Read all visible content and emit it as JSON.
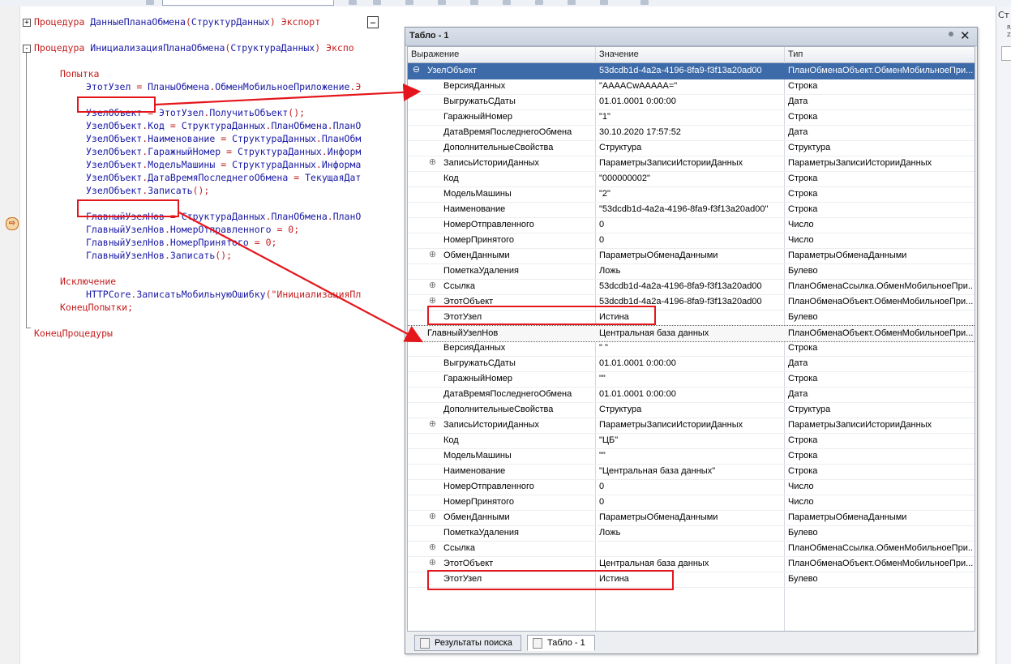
{
  "editor": {
    "lines": [
      {
        "fold": "+",
        "parts": [
          {
            "t": "Процедура ",
            "c": "kw"
          },
          {
            "t": "ДанныеПланаОбмена",
            "c": "id"
          },
          {
            "t": "(",
            "c": "kw"
          },
          {
            "t": "СтруктурДанных",
            "c": "id"
          },
          {
            "t": ") ",
            "c": "kw"
          },
          {
            "t": "Экспорт",
            "c": "kw"
          }
        ]
      },
      {
        "fold": "-",
        "parts": [
          {
            "t": "Процедура ",
            "c": "kw"
          },
          {
            "t": "ИнициализацияПланаОбмена",
            "c": "id"
          },
          {
            "t": "(",
            "c": "kw"
          },
          {
            "t": "СтруктураДанных",
            "c": "id"
          },
          {
            "t": ") ",
            "c": "kw"
          },
          {
            "t": "Экспо",
            "c": "kw"
          }
        ]
      },
      {
        "parts": [
          {
            "t": "Попытка",
            "c": "kw"
          }
        ]
      },
      {
        "parts": [
          {
            "t": "ЭтотУзел ",
            "c": "id"
          },
          {
            "t": "= ",
            "c": "kw"
          },
          {
            "t": "ПланыОбмена",
            "c": "id"
          },
          {
            "t": ".",
            "c": "kw"
          },
          {
            "t": "ОбменМобильноеПриложение",
            "c": "id"
          },
          {
            "t": ".Э",
            "c": "kw"
          }
        ]
      },
      {
        "parts": [
          {
            "t": "УзелОбъект ",
            "c": "id"
          },
          {
            "t": "= ",
            "c": "kw"
          },
          {
            "t": "ЭтотУзел",
            "c": "id"
          },
          {
            "t": ".",
            "c": "kw"
          },
          {
            "t": "ПолучитьОбъект",
            "c": "id"
          },
          {
            "t": "();",
            "c": "kw"
          }
        ]
      },
      {
        "parts": [
          {
            "t": "УзелОбъект",
            "c": "id"
          },
          {
            "t": ".",
            "c": "kw"
          },
          {
            "t": "Код ",
            "c": "id"
          },
          {
            "t": "= ",
            "c": "kw"
          },
          {
            "t": "СтруктураДанных",
            "c": "id"
          },
          {
            "t": ".",
            "c": "kw"
          },
          {
            "t": "ПланОбмена",
            "c": "id"
          },
          {
            "t": ".",
            "c": "kw"
          },
          {
            "t": "ПланО",
            "c": "id"
          }
        ]
      },
      {
        "parts": [
          {
            "t": "УзелОбъект",
            "c": "id"
          },
          {
            "t": ".",
            "c": "kw"
          },
          {
            "t": "Наименование ",
            "c": "id"
          },
          {
            "t": "= ",
            "c": "kw"
          },
          {
            "t": "СтруктураДанных",
            "c": "id"
          },
          {
            "t": ".",
            "c": "kw"
          },
          {
            "t": "ПланОбм",
            "c": "id"
          }
        ]
      },
      {
        "parts": [
          {
            "t": "УзелОбъект",
            "c": "id"
          },
          {
            "t": ".",
            "c": "kw"
          },
          {
            "t": "ГаражныйНомер ",
            "c": "id"
          },
          {
            "t": "= ",
            "c": "kw"
          },
          {
            "t": "СтруктураДанных",
            "c": "id"
          },
          {
            "t": ".",
            "c": "kw"
          },
          {
            "t": "Информ",
            "c": "id"
          }
        ]
      },
      {
        "parts": [
          {
            "t": "УзелОбъект",
            "c": "id"
          },
          {
            "t": ".",
            "c": "kw"
          },
          {
            "t": "МодельМашины ",
            "c": "id"
          },
          {
            "t": "= ",
            "c": "kw"
          },
          {
            "t": "СтруктураДанных",
            "c": "id"
          },
          {
            "t": ".",
            "c": "kw"
          },
          {
            "t": "Информа",
            "c": "id"
          }
        ]
      },
      {
        "parts": [
          {
            "t": "УзелОбъект",
            "c": "id"
          },
          {
            "t": ".",
            "c": "kw"
          },
          {
            "t": "ДатаВремяПоследнегоОбмена ",
            "c": "id"
          },
          {
            "t": "= ",
            "c": "kw"
          },
          {
            "t": "ТекущаяДат",
            "c": "id"
          }
        ]
      },
      {
        "parts": [
          {
            "t": "УзелОбъект",
            "c": "id"
          },
          {
            "t": ".",
            "c": "kw"
          },
          {
            "t": "Записать",
            "c": "id"
          },
          {
            "t": "();",
            "c": "kw"
          }
        ]
      },
      {
        "parts": [
          {
            "t": "ГлавныйУзелНов ",
            "c": "id"
          },
          {
            "t": "= ",
            "c": "kw"
          },
          {
            "t": "СтруктураДанных",
            "c": "id"
          },
          {
            "t": ".",
            "c": "kw"
          },
          {
            "t": "ПланОбмена",
            "c": "id"
          },
          {
            "t": ".",
            "c": "kw"
          },
          {
            "t": "ПланО",
            "c": "id"
          }
        ]
      },
      {
        "parts": [
          {
            "t": "ГлавныйУзелНов",
            "c": "id"
          },
          {
            "t": ".",
            "c": "kw"
          },
          {
            "t": "НомерОтправленного ",
            "c": "id"
          },
          {
            "t": "= 0;",
            "c": "kw"
          }
        ]
      },
      {
        "parts": [
          {
            "t": "ГлавныйУзелНов",
            "c": "id"
          },
          {
            "t": ".",
            "c": "kw"
          },
          {
            "t": "НомерПринятого ",
            "c": "id"
          },
          {
            "t": "= 0;",
            "c": "kw"
          }
        ]
      },
      {
        "parts": [
          {
            "t": "ГлавныйУзелНов",
            "c": "id"
          },
          {
            "t": ".",
            "c": "kw"
          },
          {
            "t": "Записать",
            "c": "id"
          },
          {
            "t": "();",
            "c": "kw"
          }
        ]
      },
      {
        "parts": [
          {
            "t": "Исключение",
            "c": "kw"
          }
        ]
      },
      {
        "parts": [
          {
            "t": "HTTPCore",
            "c": "id"
          },
          {
            "t": ".",
            "c": "kw"
          },
          {
            "t": "ЗаписатьМобильнуюОшибку",
            "c": "id"
          },
          {
            "t": "(\"ИнициализацияПл",
            "c": "kw"
          }
        ]
      },
      {
        "parts": [
          {
            "t": "КонецПопытки;",
            "c": "kw"
          }
        ]
      },
      {
        "parts": [
          {
            "t": "КонецПроцедуры",
            "c": "kw"
          }
        ]
      }
    ],
    "ellipsis": "…",
    "breakpoint_icon": "current-line-arrow-icon"
  },
  "right_panel": {
    "title": "Ст",
    "small1": "R",
    "small2": "Z"
  },
  "table_window": {
    "title": "Табло - 1",
    "columns": [
      "Выражение",
      "Значение",
      "Тип"
    ],
    "rows": [
      {
        "name": "УзелОбъект",
        "value": "53dcdb1d-4a2a-4196-8fa9-f3f13a20ad00",
        "type": "ПланОбменаОбъект.ОбменМобильноеПри...",
        "expander": "⊖",
        "level": 0,
        "selected": true
      },
      {
        "name": "ВерсияДанных",
        "value": "\"AAAACwAAAAA=\"",
        "type": "Строка",
        "expander": "",
        "level": 1
      },
      {
        "name": "ВыгружатьСДаты",
        "value": "01.01.0001 0:00:00",
        "type": "Дата",
        "expander": "",
        "level": 1
      },
      {
        "name": "ГаражныйНомер",
        "value": "\"1\"",
        "type": "Строка",
        "expander": "",
        "level": 1
      },
      {
        "name": "ДатаВремяПоследнегоОбмена",
        "value": "30.10.2020 17:57:52",
        "type": "Дата",
        "expander": "",
        "level": 1
      },
      {
        "name": "ДополнительныеСвойства",
        "value": "Структура",
        "type": "Структура",
        "expander": "",
        "level": 1
      },
      {
        "name": "ЗаписьИсторииДанных",
        "value": "ПараметрыЗаписиИсторииДанных",
        "type": "ПараметрыЗаписиИсторииДанных",
        "expander": "⊕",
        "level": 1
      },
      {
        "name": "Код",
        "value": "\"000000002\"",
        "type": "Строка",
        "expander": "",
        "level": 1
      },
      {
        "name": "МодельМашины",
        "value": "\"2\"",
        "type": "Строка",
        "expander": "",
        "level": 1
      },
      {
        "name": "Наименование",
        "value": "\"53dcdb1d-4a2a-4196-8fa9-f3f13a20ad00\"",
        "type": "Строка",
        "expander": "",
        "level": 1
      },
      {
        "name": "НомерОтправленного",
        "value": "0",
        "type": "Число",
        "expander": "",
        "level": 1
      },
      {
        "name": "НомерПринятого",
        "value": "0",
        "type": "Число",
        "expander": "",
        "level": 1
      },
      {
        "name": "ОбменДанными",
        "value": "ПараметрыОбменаДанными",
        "type": "ПараметрыОбменаДанными",
        "expander": "⊕",
        "level": 1
      },
      {
        "name": "ПометкаУдаления",
        "value": "Ложь",
        "type": "Булево",
        "expander": "",
        "level": 1
      },
      {
        "name": "Ссылка",
        "value": "53dcdb1d-4a2a-4196-8fa9-f3f13a20ad00",
        "type": "ПланОбменаСсылка.ОбменМобильноеПри...",
        "expander": "⊕",
        "level": 1
      },
      {
        "name": "ЭтотОбъект",
        "value": "53dcdb1d-4a2a-4196-8fa9-f3f13a20ad00",
        "type": "ПланОбменаОбъект.ОбменМобильноеПри...",
        "expander": "⊕",
        "level": 1
      },
      {
        "name": "ЭтотУзел",
        "value": "Истина",
        "type": "Булево",
        "expander": "",
        "level": 1
      },
      {
        "name": "ГлавныйУзелНов",
        "value": "Центральная база данных",
        "type": "ПланОбменаОбъект.ОбменМобильноеПри...",
        "expander": "",
        "level": 0,
        "dotted": true
      },
      {
        "name": "ВерсияДанных",
        "value": "\"          \"",
        "type": "Строка",
        "expander": "",
        "level": 1
      },
      {
        "name": "ВыгружатьСДаты",
        "value": "01.01.0001 0:00:00",
        "type": "Дата",
        "expander": "",
        "level": 1
      },
      {
        "name": "ГаражныйНомер",
        "value": "\"\"",
        "type": "Строка",
        "expander": "",
        "level": 1
      },
      {
        "name": "ДатаВремяПоследнегоОбмена",
        "value": "01.01.0001 0:00:00",
        "type": "Дата",
        "expander": "",
        "level": 1
      },
      {
        "name": "ДополнительныеСвойства",
        "value": "Структура",
        "type": "Структура",
        "expander": "",
        "level": 1
      },
      {
        "name": "ЗаписьИсторииДанных",
        "value": "ПараметрыЗаписиИсторииДанных",
        "type": "ПараметрыЗаписиИсторииДанных",
        "expander": "⊕",
        "level": 1
      },
      {
        "name": "Код",
        "value": "\"ЦБ\"",
        "type": "Строка",
        "expander": "",
        "level": 1
      },
      {
        "name": "МодельМашины",
        "value": "\"\"",
        "type": "Строка",
        "expander": "",
        "level": 1
      },
      {
        "name": "Наименование",
        "value": "\"Центральная база данных\"",
        "type": "Строка",
        "expander": "",
        "level": 1
      },
      {
        "name": "НомерОтправленного",
        "value": "0",
        "type": "Число",
        "expander": "",
        "level": 1
      },
      {
        "name": "НомерПринятого",
        "value": "0",
        "type": "Число",
        "expander": "",
        "level": 1
      },
      {
        "name": "ОбменДанными",
        "value": "ПараметрыОбменаДанными",
        "type": "ПараметрыОбменаДанными",
        "expander": "⊕",
        "level": 1
      },
      {
        "name": "ПометкаУдаления",
        "value": "Ложь",
        "type": "Булево",
        "expander": "",
        "level": 1
      },
      {
        "name": "Ссылка",
        "value": "",
        "type": "ПланОбменаСсылка.ОбменМобильноеПри...",
        "expander": "⊕",
        "level": 1
      },
      {
        "name": "ЭтотОбъект",
        "value": "Центральная база данных",
        "type": "ПланОбменаОбъект.ОбменМобильноеПри...",
        "expander": "⊕",
        "level": 1
      },
      {
        "name": "ЭтотУзел",
        "value": "Истина",
        "type": "Булево",
        "expander": "",
        "level": 1
      }
    ],
    "tabs": [
      {
        "label": "Результаты поиска",
        "icon": "search-results-icon"
      },
      {
        "label": "Табло - 1",
        "icon": "watch-table-icon"
      }
    ]
  },
  "annotation_color": "#e4161c"
}
